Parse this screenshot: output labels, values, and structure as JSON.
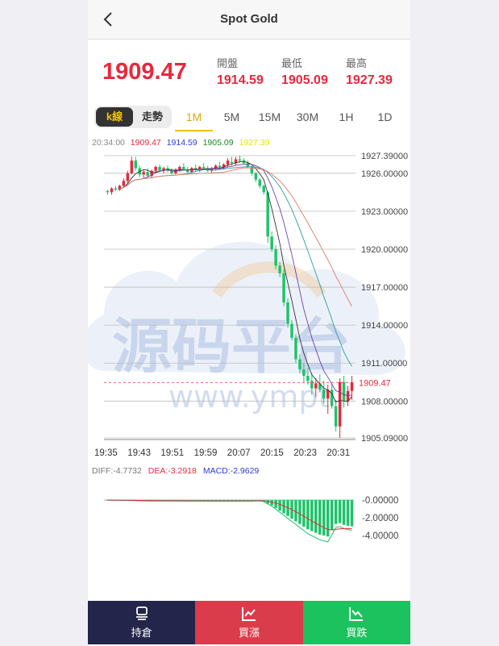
{
  "nav": {
    "title": "Spot Gold",
    "back_icon": "chevron-left-icon"
  },
  "quote": {
    "price": "1909.47",
    "open_label": "開盤",
    "open_value": "1914.59",
    "low_label": "最低",
    "low_value": "1905.09",
    "high_label": "最高",
    "high_value": "1927.39"
  },
  "mode_tabs": {
    "kline": "k線",
    "trend": "走勢"
  },
  "period_tabs": [
    "1M",
    "5M",
    "15M",
    "30M",
    "1H",
    "1D"
  ],
  "active_period": "1M",
  "info_bar": {
    "time": "20:34:00",
    "close": "1909.47",
    "open": "1914.59",
    "low": "1905.09",
    "high": "1927.39"
  },
  "price_axis": [
    "1927.39000",
    "1926.00000",
    "1923.00000",
    "1920.00000",
    "1917.00000",
    "1914.00000",
    "1911.00000",
    "1908.00000",
    "1905.09000"
  ],
  "time_axis": [
    "19:35",
    "19:43",
    "19:51",
    "19:59",
    "20:07",
    "20:15",
    "20:23",
    "20:31"
  ],
  "last_price_tag": "1909.47",
  "macd_info": {
    "diff": "DIFF:-4.7732",
    "dea": "DEA:-3.2918",
    "macd": "MACD:-2.9629"
  },
  "macd_axis": [
    "-0.00000",
    "-2.00000",
    "-4.00000"
  ],
  "watermark": {
    "cn": "源码平台",
    "url": "www.ympt"
  },
  "bottom_bar": {
    "hold": "持倉",
    "buy_up": "買漲",
    "buy_down": "買跌"
  },
  "colors": {
    "up": "#e8283c",
    "down": "#1ec36a",
    "accent": "#f2c200",
    "navy": "#23254a"
  },
  "chart_data": {
    "type": "candlestick",
    "ylim": [
      1905.09,
      1927.39
    ],
    "x": [
      "19:35",
      "19:43",
      "19:51",
      "19:59",
      "20:07",
      "20:15",
      "20:23",
      "20:31"
    ],
    "last": 1909.47,
    "candles": [
      [
        1924.6,
        1924.7,
        1924.3,
        1924.5
      ],
      [
        1924.5,
        1924.9,
        1924.3,
        1924.8
      ],
      [
        1924.8,
        1925.0,
        1924.6,
        1924.7
      ],
      [
        1924.7,
        1925.1,
        1924.6,
        1925.0
      ],
      [
        1925.0,
        1925.6,
        1924.9,
        1925.4
      ],
      [
        1925.4,
        1926.2,
        1925.2,
        1926.0
      ],
      [
        1926.0,
        1927.3,
        1925.9,
        1927.0
      ],
      [
        1927.0,
        1927.3,
        1926.2,
        1926.4
      ],
      [
        1926.4,
        1926.6,
        1925.7,
        1925.9
      ],
      [
        1925.9,
        1926.3,
        1925.6,
        1926.1
      ],
      [
        1926.1,
        1926.4,
        1925.7,
        1925.8
      ],
      [
        1925.8,
        1926.3,
        1925.6,
        1926.2
      ],
      [
        1926.2,
        1926.6,
        1926.0,
        1926.5
      ],
      [
        1926.5,
        1926.7,
        1926.1,
        1926.2
      ],
      [
        1926.2,
        1926.5,
        1926.0,
        1926.4
      ],
      [
        1926.4,
        1926.6,
        1926.1,
        1926.2
      ],
      [
        1926.2,
        1926.4,
        1925.9,
        1926.0
      ],
      [
        1926.0,
        1926.4,
        1925.9,
        1926.3
      ],
      [
        1926.3,
        1926.6,
        1926.1,
        1926.5
      ],
      [
        1926.5,
        1926.8,
        1926.2,
        1926.3
      ],
      [
        1926.3,
        1926.5,
        1926.0,
        1926.1
      ],
      [
        1926.1,
        1926.5,
        1926.0,
        1926.4
      ],
      [
        1926.4,
        1926.7,
        1926.2,
        1926.3
      ],
      [
        1926.3,
        1926.6,
        1926.1,
        1926.5
      ],
      [
        1926.5,
        1926.8,
        1926.3,
        1926.4
      ],
      [
        1926.4,
        1926.6,
        1926.1,
        1926.2
      ],
      [
        1926.2,
        1926.5,
        1926.0,
        1926.4
      ],
      [
        1926.4,
        1926.7,
        1926.2,
        1926.6
      ],
      [
        1926.6,
        1926.9,
        1926.4,
        1926.5
      ],
      [
        1926.5,
        1926.8,
        1926.3,
        1926.7
      ],
      [
        1926.7,
        1927.2,
        1926.5,
        1927.0
      ],
      [
        1926.9,
        1927.3,
        1926.6,
        1926.8
      ],
      [
        1926.8,
        1927.3,
        1926.6,
        1927.1
      ],
      [
        1927.1,
        1927.4,
        1926.8,
        1927.0
      ],
      [
        1927.0,
        1927.2,
        1926.7,
        1926.8
      ],
      [
        1926.8,
        1927.0,
        1926.4,
        1926.5
      ],
      [
        1926.5,
        1926.6,
        1925.8,
        1926.0
      ],
      [
        1926.0,
        1926.1,
        1925.3,
        1925.5
      ],
      [
        1925.5,
        1925.6,
        1924.8,
        1925.0
      ],
      [
        1925.0,
        1925.1,
        1924.3,
        1924.5
      ],
      [
        1924.5,
        1924.6,
        1920.5,
        1921.0
      ],
      [
        1921.0,
        1921.4,
        1919.8,
        1920.0
      ],
      [
        1920.0,
        1920.3,
        1918.4,
        1918.7
      ],
      [
        1918.7,
        1919.0,
        1917.8,
        1918.1
      ],
      [
        1918.1,
        1918.4,
        1915.5,
        1915.8
      ],
      [
        1915.8,
        1916.1,
        1913.8,
        1914.1
      ],
      [
        1914.1,
        1914.4,
        1912.8,
        1913.0
      ],
      [
        1913.0,
        1913.3,
        1911.0,
        1911.3
      ],
      [
        1911.3,
        1911.7,
        1910.2,
        1910.5
      ],
      [
        1910.5,
        1911.0,
        1909.5,
        1910.0
      ],
      [
        1910.0,
        1910.6,
        1909.3,
        1909.6
      ],
      [
        1909.6,
        1910.2,
        1908.5,
        1909.0
      ],
      [
        1909.0,
        1909.8,
        1908.3,
        1909.4
      ],
      [
        1909.4,
        1910.1,
        1908.7,
        1908.9
      ],
      [
        1908.9,
        1909.6,
        1907.8,
        1908.2
      ],
      [
        1908.2,
        1909.3,
        1907.0,
        1908.9
      ],
      [
        1908.9,
        1909.4,
        1907.4,
        1907.6
      ],
      [
        1907.6,
        1908.1,
        1905.6,
        1906.0
      ],
      [
        1906.0,
        1909.8,
        1905.09,
        1909.5
      ],
      [
        1909.5,
        1910.0,
        1907.5,
        1908.0
      ],
      [
        1908.0,
        1909.2,
        1907.6,
        1908.8
      ],
      [
        1908.8,
        1910.0,
        1908.1,
        1909.47
      ]
    ],
    "macd": [
      -0.02,
      -0.02,
      -0.03,
      -0.03,
      -0.04,
      -0.05,
      -0.06,
      -0.07,
      -0.08,
      -0.09,
      -0.1,
      -0.1,
      -0.1,
      -0.1,
      -0.1,
      -0.1,
      -0.1,
      -0.1,
      -0.1,
      -0.1,
      -0.1,
      -0.1,
      -0.1,
      -0.1,
      -0.1,
      -0.1,
      -0.1,
      -0.1,
      -0.1,
      -0.1,
      -0.1,
      -0.1,
      -0.1,
      -0.1,
      -0.1,
      -0.1,
      -0.1,
      -0.05,
      -0.08,
      -0.15,
      -0.4,
      -0.6,
      -0.9,
      -1.2,
      -1.5,
      -1.8,
      -2.1,
      -2.4,
      -2.7,
      -3.0,
      -3.3,
      -3.5,
      -3.7,
      -3.9,
      -4.0,
      -4.1,
      -3.4,
      -2.7,
      -2.6,
      -2.8,
      -2.9,
      -2.96
    ]
  }
}
